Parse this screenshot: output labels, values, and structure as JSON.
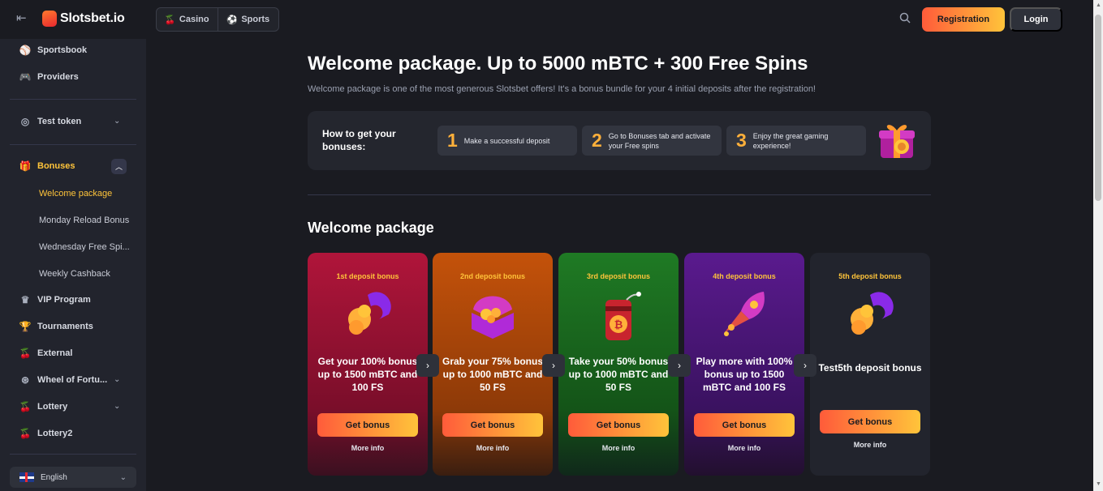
{
  "header": {
    "logo_text": "Slotsbet.io",
    "tabs": [
      {
        "label": "Casino",
        "icon": "cherry-icon"
      },
      {
        "label": "Sports",
        "icon": "ball-icon"
      }
    ],
    "registration_label": "Registration",
    "login_label": "Login"
  },
  "sidebar": {
    "items": [
      {
        "label": "Sportsbook",
        "icon": "sportsbook-icon"
      },
      {
        "label": "Providers",
        "icon": "gamepad-icon"
      },
      {
        "label": "Test token",
        "icon": "token-icon"
      },
      {
        "label": "Bonuses",
        "icon": "gift-icon"
      },
      {
        "label": "VIP Program",
        "icon": "crown-icon"
      },
      {
        "label": "Tournaments",
        "icon": "trophy-icon"
      },
      {
        "label": "External",
        "icon": "cherry-icon"
      },
      {
        "label": "Wheel of Fortu...",
        "icon": "wheel-icon"
      },
      {
        "label": "Lottery",
        "icon": "cherry-icon"
      },
      {
        "label": "Lottery2",
        "icon": "cherry-icon"
      }
    ],
    "bonus_subitems": [
      "Welcome package",
      "Monday Reload Bonus",
      "Wednesday Free Spi...",
      "Weekly Cashback"
    ],
    "language": "English"
  },
  "page": {
    "title": "Welcome package. Up to 5000 mBTC + 300 Free Spins",
    "subtitle": "Welcome package is one of the most generous Slotsbet offers! It's a bonus bundle for your 4 initial deposits after the registration!",
    "howto_title": "How to get your bonuses:",
    "steps": [
      {
        "num": "1",
        "text": "Make a successful deposit"
      },
      {
        "num": "2",
        "text": "Go to Bonuses tab and activate your Free spins"
      },
      {
        "num": "3",
        "text": "Enjoy the great gaming experience!"
      }
    ],
    "section_title": "Welcome package"
  },
  "cards": [
    {
      "label": "1st deposit bonus",
      "desc": "Get your 100% bonus up to 1500 mBTC and 100 FS",
      "button": "Get bonus",
      "more": "More info"
    },
    {
      "label": "2nd deposit bonus",
      "desc": "Grab your 75% bonus up to 1000 mBTC and 50 FS",
      "button": "Get bonus",
      "more": "More info"
    },
    {
      "label": "3rd deposit bonus",
      "desc": "Take your 50% bonus up to 1000 mBTC and 50 FS",
      "button": "Get bonus",
      "more": "More info"
    },
    {
      "label": "4th deposit bonus",
      "desc": "Play more with 100% bonus up to 1500 mBTC and 100 FS",
      "button": "Get bonus",
      "more": "More info"
    },
    {
      "label": "5th deposit bonus",
      "desc": "Test5th deposit bonus",
      "button": "Get bonus",
      "more": "More info"
    }
  ],
  "colors": {
    "accent": "#ffc43a",
    "accent_orange": "#ff5b3a",
    "background": "#1a1b21",
    "sidebar": "#22242d"
  }
}
